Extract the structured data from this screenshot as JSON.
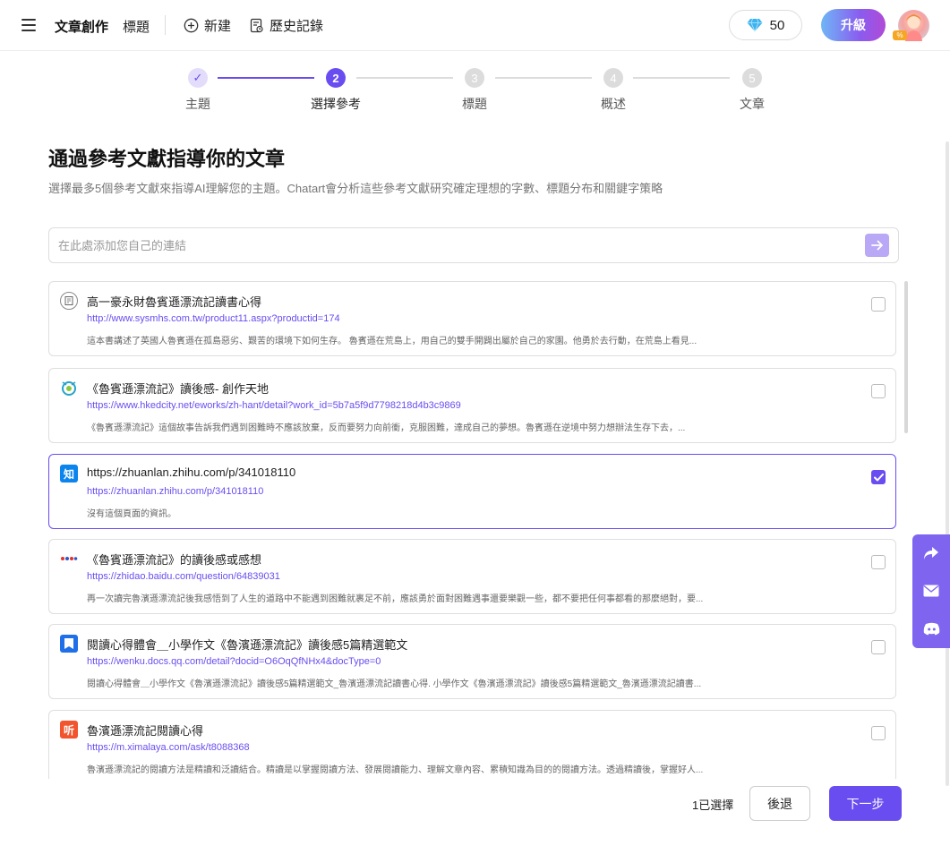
{
  "header": {
    "app_title": "文章創作",
    "sub_title": "標題",
    "new_label": "新建",
    "history_label": "歷史記錄",
    "credits": "50",
    "upgrade_label": "升級",
    "avatar_badge": "%"
  },
  "stepper": {
    "steps": [
      {
        "number": "✓",
        "label": "主題",
        "state": "done"
      },
      {
        "number": "2",
        "label": "選擇參考",
        "state": "active"
      },
      {
        "number": "3",
        "label": "標題",
        "state": "todo"
      },
      {
        "number": "4",
        "label": "概述",
        "state": "todo"
      },
      {
        "number": "5",
        "label": "文章",
        "state": "todo"
      }
    ]
  },
  "main": {
    "heading": "通過參考文獻指導你的文章",
    "subheading": "選擇最多5個參考文獻來指導AI理解您的主題。Chatart會分析這些參考文獻研究確定理想的字數、標題分布和關鍵字策略",
    "link_placeholder": "在此處添加您自己的連結"
  },
  "references": [
    {
      "icon": "document-icon",
      "title": "高一豪永財魯賓遜漂流記讀書心得",
      "url": "http://www.sysmhs.com.tw/product11.aspx?productid=174",
      "desc": "這本書講述了英國人魯賓遜在孤島惡劣、艱苦的環境下如何生存。 魯賓遜在荒島上，用自己的雙手開闢出屬於自己的家園。他勇於去行動，在荒島上看見...",
      "checked": false
    },
    {
      "icon": "hkedcity-icon",
      "title": "《魯賓遜漂流記》讀後感- 創作天地",
      "url": "https://www.hkedcity.net/eworks/zh-hant/detail?work_id=5b7a5f9d7798218d4b3c9869",
      "desc": "《魯賓遜漂流記》這個故事告訴我們遇到困難時不應該放棄，反而要努力向前衝，克服困難，達成自己的夢想。魯賓遜在逆境中努力想辦法生存下去，...",
      "checked": false
    },
    {
      "icon": "zhihu-icon",
      "title": "https://zhuanlan.zhihu.com/p/341018110",
      "url": "https://zhuanlan.zhihu.com/p/341018110",
      "desc": "沒有這個頁面的資訊。",
      "checked": true
    },
    {
      "icon": "baidu-icon",
      "title": "《魯賓遜漂流記》的讀後感或感想",
      "url": "https://zhidao.baidu.com/question/64839031",
      "desc": "再一次讀完魯濱遜漂流記後我感悟到了人生的道路中不能遇到困難就裹足不前，應該勇於面對困難遇事還要樂觀一些，都不要把任何事都看的那麼絕對，要...",
      "checked": false
    },
    {
      "icon": "tencent-docs-icon",
      "title": "閱讀心得體會＿小學作文《魯濱遜漂流記》讀後感5篇精選範文",
      "url": "https://wenku.docs.qq.com/detail?docid=O6OqQfNHx4&docType=0",
      "desc": "閱讀心得體會＿小學作文《魯濱遜漂流記》讀後感5篇精選範文_魯濱遜漂流記讀書心得. 小學作文《魯濱遜漂流記》讀後感5篇精選範文_魯濱遜漂流記讀書...",
      "checked": false
    },
    {
      "icon": "ximalaya-icon",
      "title": "魯濱遜漂流記閱讀心得",
      "url": "https://m.ximalaya.com/ask/t8088368",
      "desc": "魯濱遜漂流記的閱讀方法是精讀和泛讀結合。精讀是以掌握閱讀方法、發展閱讀能力、理解文章內容、累積知識為目的的閱讀方法。透過精讀後，掌握好人...",
      "checked": false
    }
  ],
  "footer": {
    "selected_count": "1已選擇",
    "back_label": "後退",
    "next_label": "下一步"
  },
  "side_float": {
    "items": [
      "share-icon",
      "mail-icon",
      "discord-icon"
    ]
  }
}
